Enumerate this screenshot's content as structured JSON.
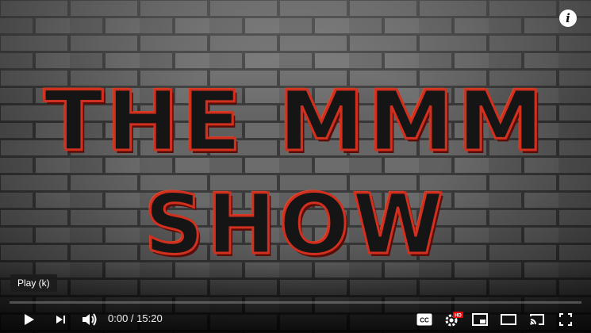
{
  "video": {
    "title_line_1": "THE MMM",
    "title_line_2": "SHOW"
  },
  "player": {
    "tooltip": "Play (k)",
    "current_time": "0:00",
    "separator": " / ",
    "duration": "15:20",
    "progress_fraction": 0,
    "accent_color": "#ff0000",
    "icons": [
      "info-icon",
      "play-icon",
      "next-icon",
      "volume-icon",
      "subtitles-icon",
      "settings-icon",
      "hd-badge",
      "miniplayer-icon",
      "theater-icon",
      "cast-icon",
      "fullscreen-icon"
    ],
    "hd_label": "HD",
    "cc_label": "CC"
  }
}
